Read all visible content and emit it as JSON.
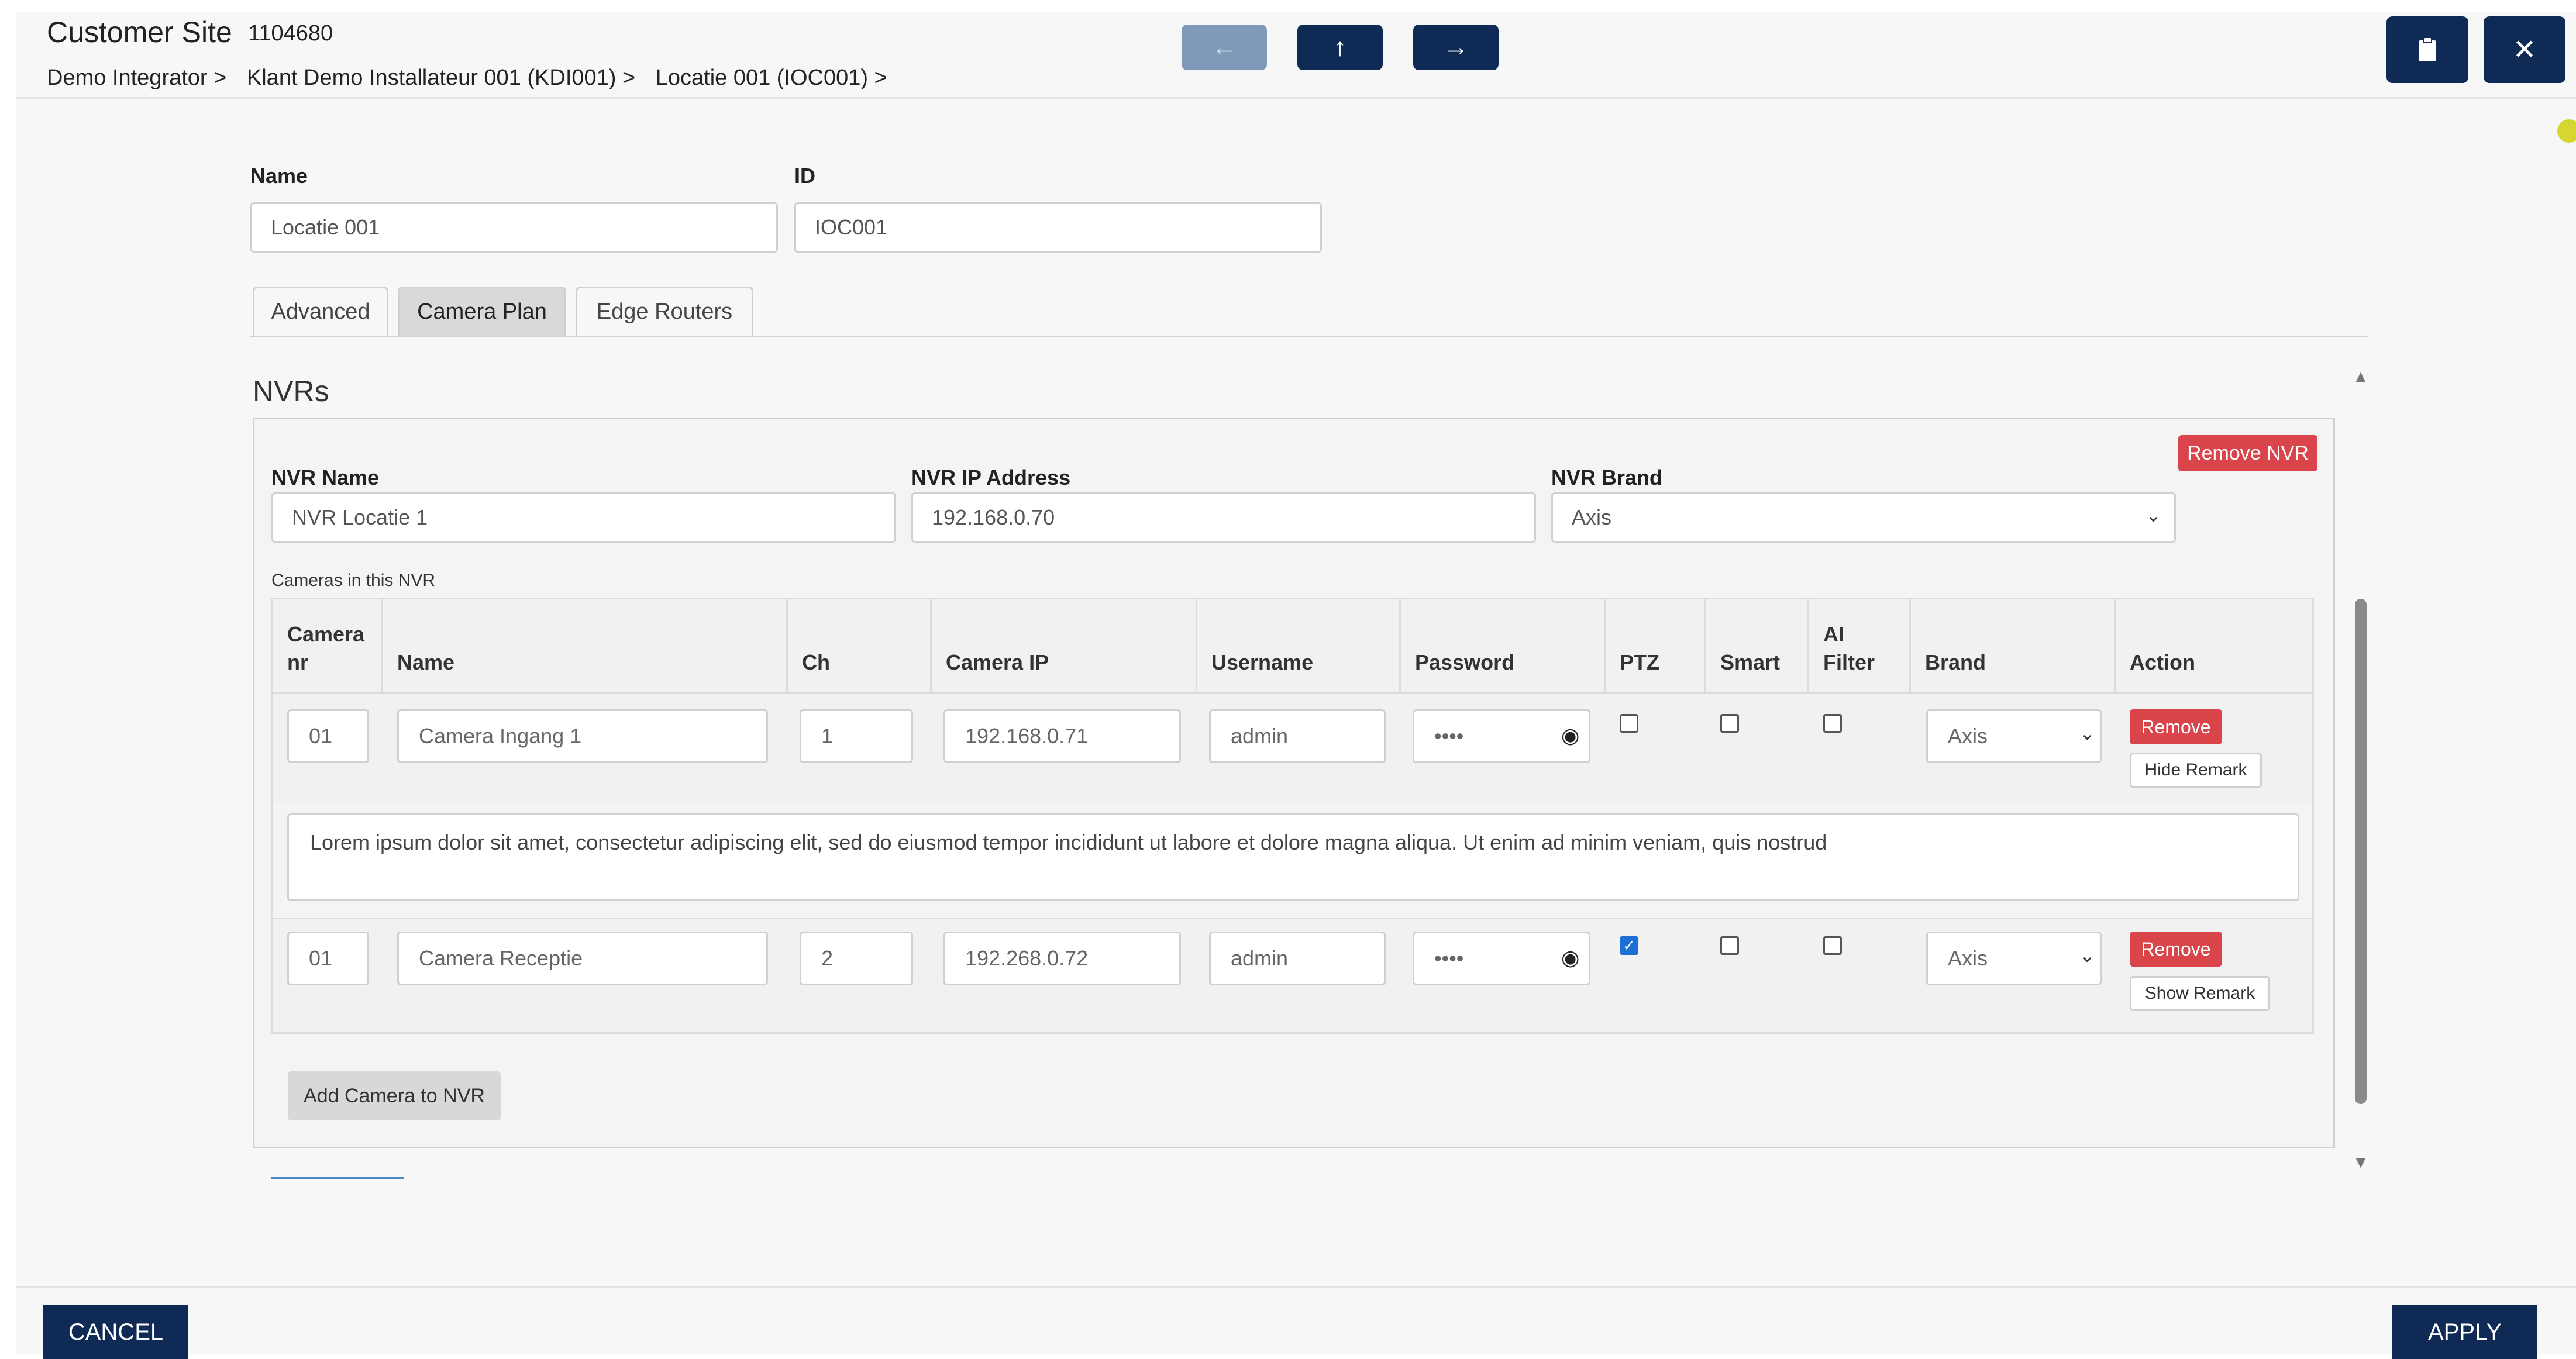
{
  "header": {
    "title": "Customer Site",
    "site_id": "1104680",
    "breadcrumbs": [
      "Demo Integrator >",
      "Klant Demo Installateur 001 (KDI001) >",
      "Locatie 001 (IOC001) >"
    ],
    "nav_icons": {
      "back": "arrow-left-icon",
      "up": "arrow-up-icon",
      "forward": "arrow-right-icon"
    },
    "actions": {
      "clipboard_icon": "clipboard-icon",
      "close_icon": "close-icon"
    }
  },
  "form": {
    "name_label": "Name",
    "name_value": "Locatie 001",
    "id_label": "ID",
    "id_value": "IOC001"
  },
  "tabs": [
    {
      "label": "Advanced",
      "active": false
    },
    {
      "label": "Camera Plan",
      "active": true
    },
    {
      "label": "Edge Routers",
      "active": false
    }
  ],
  "nvrs": {
    "section_title": "NVRs",
    "remove_nvr_label": "Remove NVR",
    "nvr_name_label": "NVR Name",
    "nvr_name_value": "NVR Locatie 1",
    "nvr_ip_label": "NVR IP Address",
    "nvr_ip_value": "192.168.0.70",
    "nvr_brand_label": "NVR Brand",
    "nvr_brand_value": "Axis",
    "cameras_label": "Cameras in this NVR",
    "columns": [
      "Camera nr",
      "Name",
      "Ch",
      "Camera IP",
      "Username",
      "Password",
      "PTZ",
      "Smart",
      "AI Filter",
      "Brand",
      "Action"
    ],
    "cameras": [
      {
        "nr": "01",
        "name": "Camera Ingang 1",
        "ch": "1",
        "ip": "192.168.0.71",
        "username": "admin",
        "password": "••••",
        "ptz": false,
        "smart": false,
        "ai_filter": false,
        "brand": "Axis",
        "remove_label": "Remove",
        "remark_label": "Hide Remark",
        "remark": "Lorem ipsum dolor sit amet, consectetur adipiscing elit, sed do eiusmod tempor incididunt ut labore et dolore magna aliqua. Ut enim ad minim veniam, quis nostrud"
      },
      {
        "nr": "01",
        "name": "Camera Receptie",
        "ch": "2",
        "ip": "192.268.0.72",
        "username": "admin",
        "password": "••••",
        "ptz": true,
        "smart": false,
        "ai_filter": false,
        "brand": "Axis",
        "remove_label": "Remove",
        "remark_label": "Show Remark"
      }
    ],
    "add_camera_label": "Add Camera to NVR"
  },
  "footer": {
    "cancel_label": "CANCEL",
    "apply_label": "APPLY"
  },
  "colors": {
    "primary": "#0f2a55",
    "danger": "#d9454a",
    "checkbox_checked": "#1c6fd6"
  }
}
